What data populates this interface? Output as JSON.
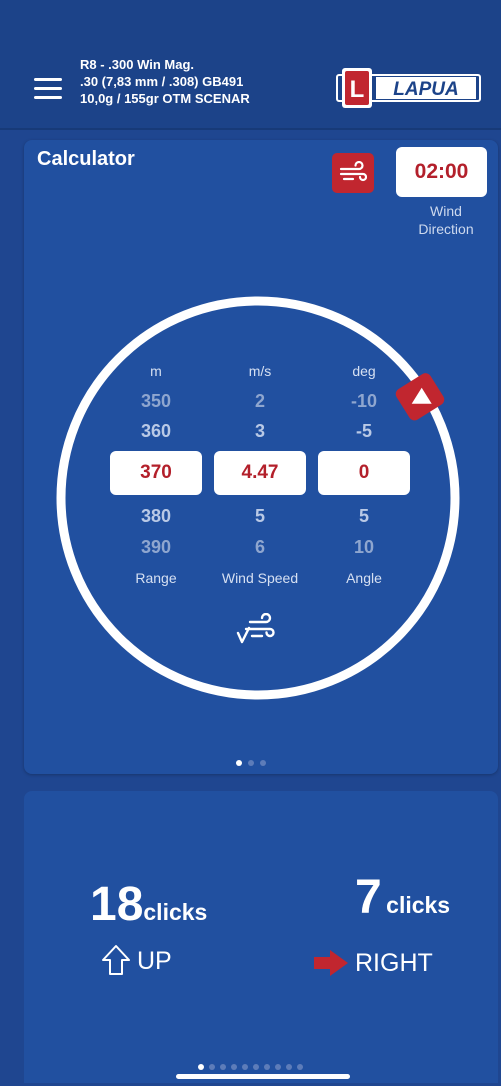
{
  "header": {
    "profile_line1": "R8 - .300 Win Mag.",
    "profile_line2": ".30 (7,83 mm / .308) GB491",
    "profile_line3": "10,0g / 155gr OTM SCENAR",
    "logo_letter": "L",
    "logo_text": "LAPUA"
  },
  "calculator": {
    "title": "Calculator",
    "wind_direction_value": "02:00",
    "wind_direction_label_1": "Wind",
    "wind_direction_label_2": "Direction",
    "wind_direction_icon": "wind-icon",
    "range": {
      "unit": "m",
      "above": [
        "350",
        "360"
      ],
      "selected": "370",
      "below": [
        "380",
        "390"
      ],
      "label": "Range"
    },
    "wind_speed": {
      "unit": "m/s",
      "above": [
        "2",
        "3"
      ],
      "selected": "4.47",
      "below": [
        "5",
        "6"
      ],
      "label": "Wind Speed"
    },
    "angle": {
      "unit": "deg",
      "above": [
        "-10",
        "-5"
      ],
      "selected": "0",
      "below": [
        "5",
        "10"
      ],
      "label": "Angle"
    },
    "page_count": 3,
    "page_active": 1
  },
  "result": {
    "elevation_clicks": "18",
    "elevation_word": "clicks",
    "elevation_dir": "UP",
    "windage_clicks": "7",
    "windage_word": "clicks",
    "windage_dir": "RIGHT"
  },
  "bottom_pager": {
    "count": 10,
    "active": 1
  },
  "colors": {
    "background": "#1f4690",
    "card": "#2150a0",
    "accent_red": "#c1262f",
    "value_red": "#b3202b"
  }
}
